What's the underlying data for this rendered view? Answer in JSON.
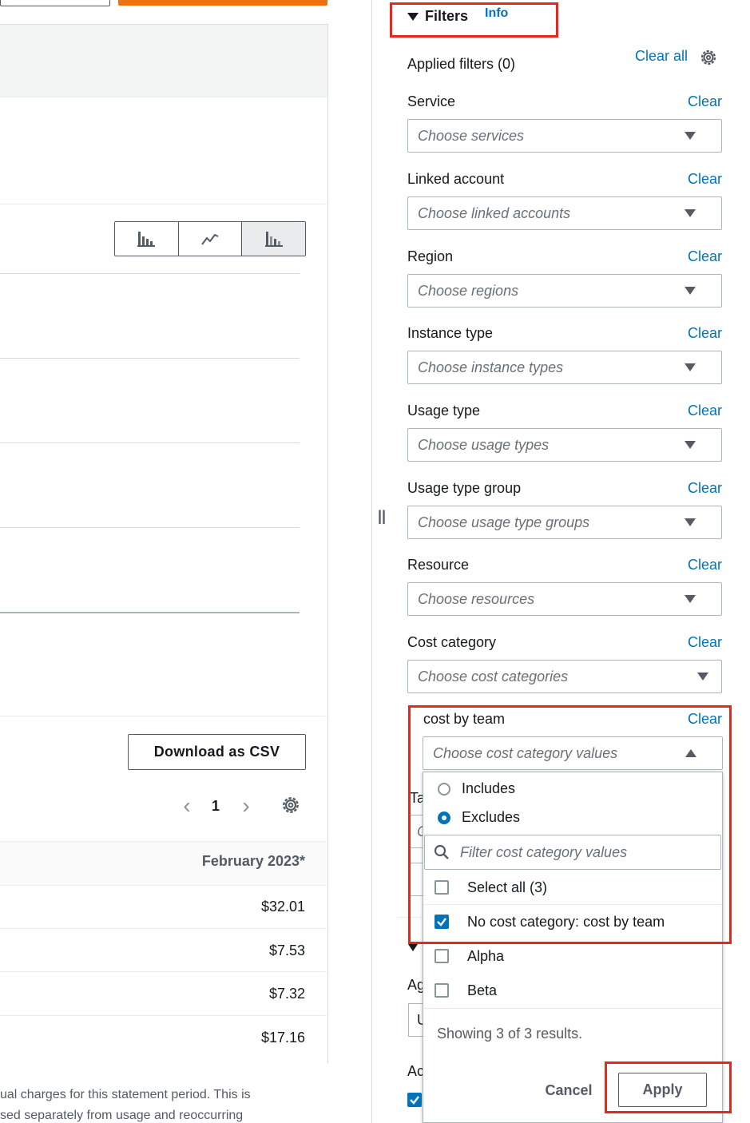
{
  "left": {
    "csv_button": "Download as CSV",
    "pager": {
      "prev": "‹",
      "page": "1",
      "next": "›"
    },
    "table": {
      "column_header": "February 2023*",
      "rows": [
        "$32.01",
        "$7.53",
        "$7.32",
        "$17.16"
      ]
    },
    "footnote_lines": [
      "ual charges for this statement period. This is",
      "sed separately from usage and reoccurring"
    ]
  },
  "filters": {
    "title": "Filters",
    "info": "Info",
    "applied": "Applied filters (0)",
    "clear_all": "Clear all",
    "groups": [
      {
        "label": "Service",
        "clear": "Clear",
        "placeholder": "Choose services"
      },
      {
        "label": "Linked account",
        "clear": "Clear",
        "placeholder": "Choose linked accounts"
      },
      {
        "label": "Region",
        "clear": "Clear",
        "placeholder": "Choose regions"
      },
      {
        "label": "Instance type",
        "clear": "Clear",
        "placeholder": "Choose instance types"
      },
      {
        "label": "Usage type",
        "clear": "Clear",
        "placeholder": "Choose usage types"
      },
      {
        "label": "Usage type group",
        "clear": "Clear",
        "placeholder": "Choose usage type groups"
      },
      {
        "label": "Resource",
        "clear": "Clear",
        "placeholder": "Choose resources"
      },
      {
        "label": "Cost category",
        "clear": "Clear",
        "placeholder": "Choose cost categories"
      }
    ],
    "cost_by_team": {
      "label": "cost by team",
      "clear": "Clear",
      "placeholder": "Choose cost category values",
      "radios": [
        {
          "label": "Includes",
          "selected": false
        },
        {
          "label": "Excludes",
          "selected": true
        }
      ],
      "search_placeholder": "Filter cost category values",
      "options": [
        {
          "label": "Select all (3)",
          "checked": false
        },
        {
          "label": "No cost category: cost by team",
          "checked": true
        },
        {
          "label": "Alpha",
          "checked": false
        },
        {
          "label": "Beta",
          "checked": false
        }
      ],
      "showing": "Showing 3 of 3 results.",
      "cancel": "Cancel",
      "apply": "Apply"
    },
    "hidden_fragments": [
      "Ta",
      "C",
      "Ag",
      "U",
      "Ac"
    ]
  },
  "colors": {
    "link": "#0073bb",
    "highlight": "#e8261c",
    "accent_orange": "#ec7211"
  }
}
